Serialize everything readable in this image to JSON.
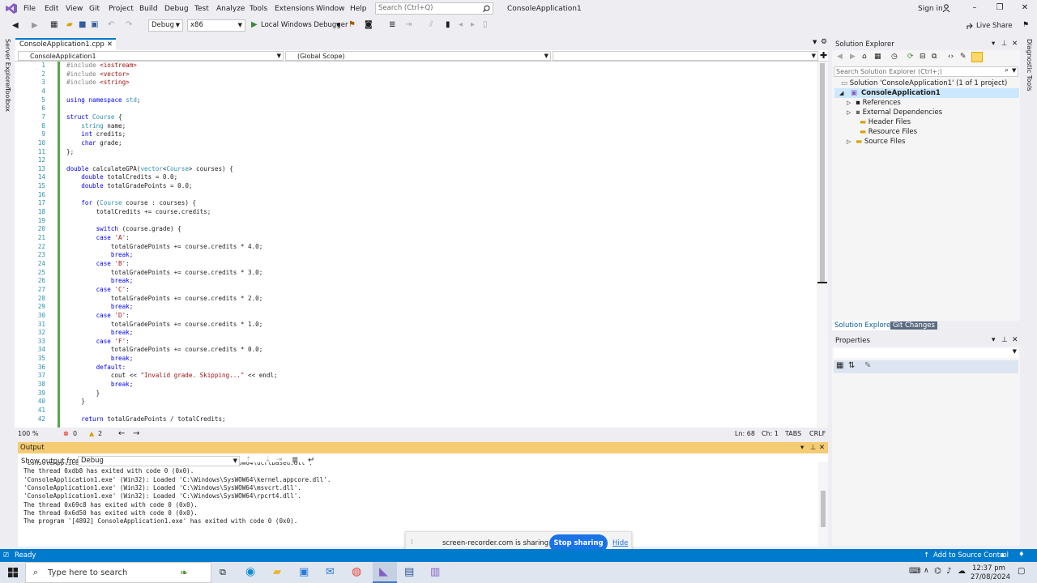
{
  "menubar": {
    "items": [
      "File",
      "Edit",
      "View",
      "Git",
      "Project",
      "Build",
      "Debug",
      "Test",
      "Analyze",
      "Tools",
      "Extensions",
      "Window",
      "Help"
    ],
    "search_placeholder": "Search (Ctrl+Q)",
    "app_title": "ConsoleApplication1",
    "signin": "Sign in",
    "live_share": "Live Share"
  },
  "toolbar": {
    "config": "Debug",
    "platform": "x86",
    "run_label": "Local Windows Debugger"
  },
  "left_sidebar": {
    "server_explorer": "Server Explorer",
    "toolbox": "Toolbox"
  },
  "right_sidebar": {
    "diagnostic": "Diagnostic Tools"
  },
  "editor": {
    "tab": "ConsoleApplication1.cpp",
    "nav_left": "ConsoleApplication1",
    "nav_mid": "(Global Scope)",
    "lines": [
      "#include <iostream>",
      "#include <vector>",
      "#include <string>",
      "",
      "using namespace std;",
      "",
      "struct Course {",
      "    string name;",
      "    int credits;",
      "    char grade;",
      "};",
      "",
      "double calculateGPA(vector<Course> courses) {",
      "    double totalCredits = 0.0;",
      "    double totalGradePoints = 0.0;",
      "",
      "    for (Course course : courses) {",
      "        totalCredits += course.credits;",
      "",
      "        switch (course.grade) {",
      "        case 'A':",
      "            totalGradePoints += course.credits * 4.0;",
      "            break;",
      "        case 'B':",
      "            totalGradePoints += course.credits * 3.0;",
      "            break;",
      "        case 'C':",
      "            totalGradePoints += course.credits * 2.0;",
      "            break;",
      "        case 'D':",
      "            totalGradePoints += course.credits * 1.0;",
      "            break;",
      "        case 'F':",
      "            totalGradePoints += course.credits * 0.0;",
      "            break;",
      "        default:",
      "            cout << \"Invalid grade. Skipping...\" << endl;",
      "            break;",
      "        }",
      "    }",
      "",
      "    return totalGradePoints / totalCredits;"
    ],
    "line_numbers": [
      "1",
      "2",
      "3",
      "4",
      "5",
      "6",
      "7",
      "8",
      "9",
      "10",
      "11",
      "12",
      "13",
      "14",
      "15",
      "16",
      "17",
      "18",
      "19",
      "20",
      "21",
      "22",
      "23",
      "24",
      "25",
      "26",
      "27",
      "28",
      "29",
      "30",
      "31",
      "32",
      "33",
      "34",
      "35",
      "36",
      "37",
      "38",
      "39",
      "40",
      "41",
      "42"
    ],
    "status": {
      "zoom": "100 %",
      "errors": "0",
      "warnings": "2",
      "ln": "Ln: 68",
      "ch": "Ch: 1",
      "tabs": "TABS",
      "eol": "CRLF"
    }
  },
  "solution_explorer": {
    "title": "Solution Explorer",
    "search_placeholder": "Search Solution Explorer (Ctrl+;)",
    "solution": "Solution 'ConsoleApplication1' (1 of 1 project)",
    "project": "ConsoleApplication1",
    "items": [
      "References",
      "External Dependencies",
      "Header Files",
      "Resource Files",
      "Source Files"
    ],
    "tabs": [
      "Solution Explorer",
      "Git Changes"
    ]
  },
  "properties": {
    "title": "Properties"
  },
  "output": {
    "title": "Output",
    "show_from_label": "Show output from:",
    "source": "Debug",
    "lines": [
      "'ConsoleApplication1.exe' (Win32): Loaded 'C:\\Windows\\SysWOW64\\ucrtbased.dll'.",
      "The thread 0xdb8 has exited with code 0 (0x0).",
      "'ConsoleApplication1.exe' (Win32): Loaded 'C:\\Windows\\SysWOW64\\kernel.appcore.dll'.",
      "'ConsoleApplication1.exe' (Win32): Loaded 'C:\\Windows\\SysWOW64\\msvcrt.dll'.",
      "'ConsoleApplication1.exe' (Win32): Loaded 'C:\\Windows\\SysWOW64\\rpcrt4.dll'.",
      "The thread 0x69c8 has exited with code 0 (0x0).",
      "The thread 0x6d50 has exited with code 0 (0x0).",
      "The program '[4892] ConsoleApplication1.exe' has exited with code 0 (0x0)."
    ]
  },
  "share_bar": {
    "text": "screen-recorder.com is sharing your screen.",
    "stop": "Stop sharing",
    "hide": "Hide"
  },
  "statusbar": {
    "ready": "Ready",
    "source_control": "Add to Source Control"
  },
  "taskbar": {
    "search_placeholder": "Type here to search",
    "time": "12:37 pm",
    "date": "27/08/2024"
  }
}
